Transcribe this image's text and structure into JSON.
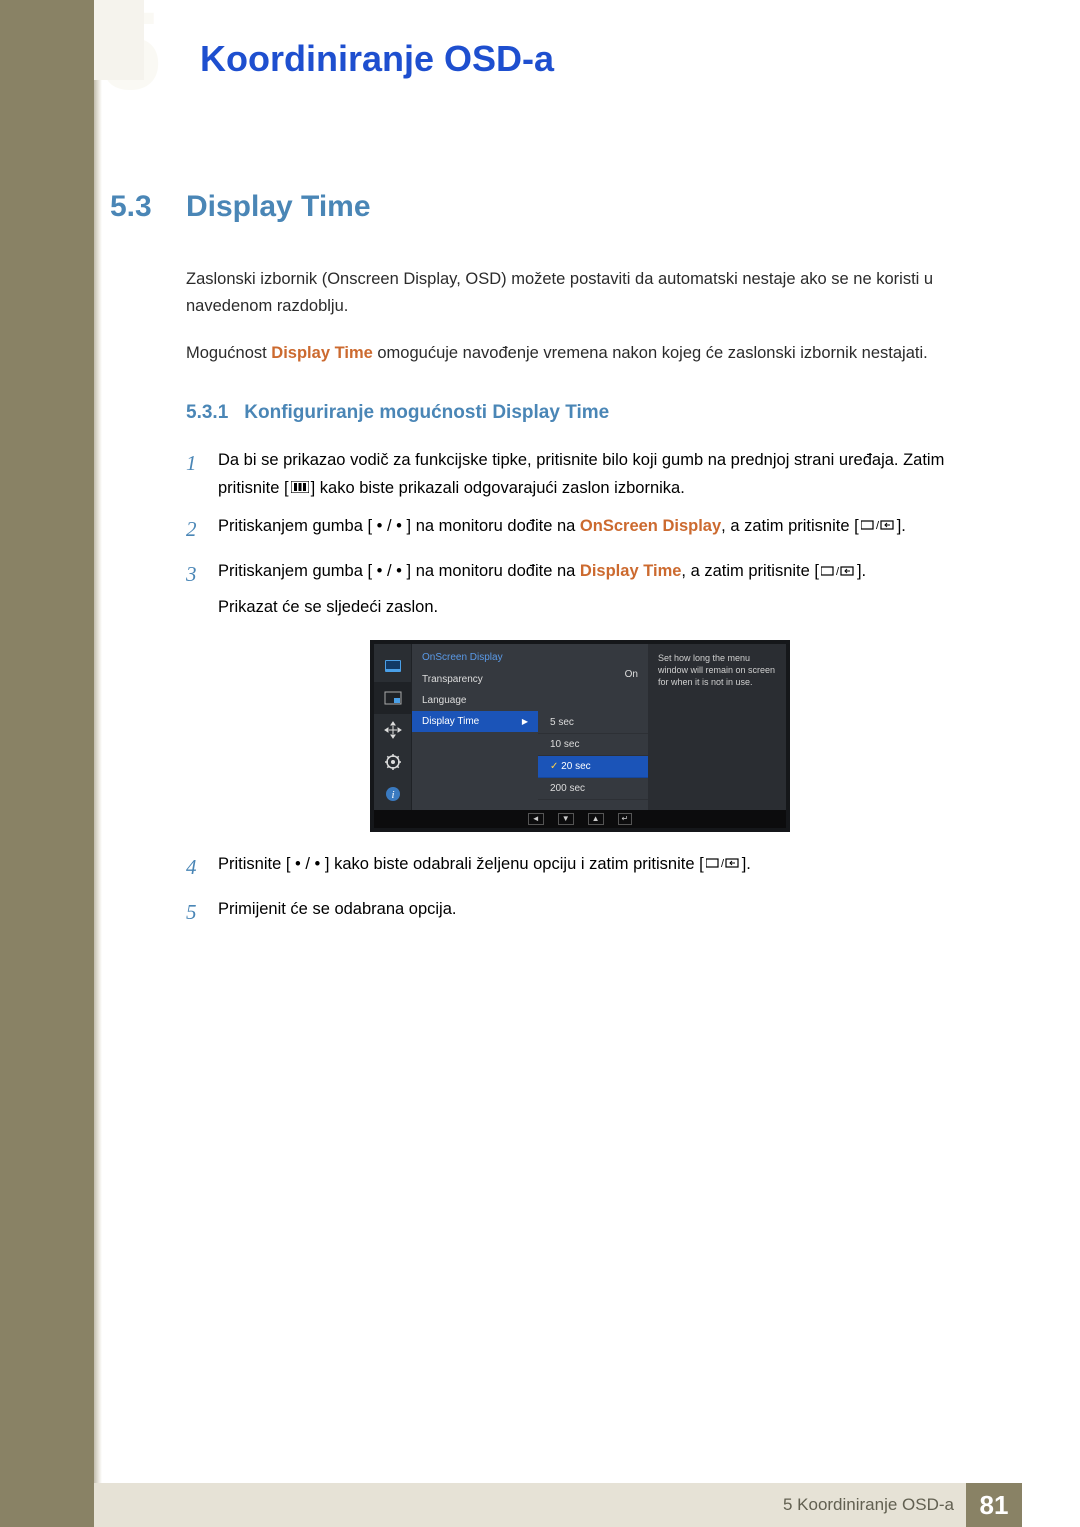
{
  "chapter_tab_number": "5",
  "doc_title": "Koordiniranje OSD-a",
  "section": {
    "num": "5.3",
    "title": "Display Time"
  },
  "intro_p1": "Zaslonski izbornik (Onscreen Display, OSD) možete postaviti da automatski nestaje ako se ne koristi u navedenom razdoblju.",
  "intro_p2_a": "Mogućnost ",
  "intro_p2_hl": "Display Time",
  "intro_p2_b": " omogućuje navođenje vremena nakon kojeg će zaslonski izbornik nestajati.",
  "subsection": {
    "num": "5.3.1",
    "title": "Konfiguriranje mogućnosti Display Time"
  },
  "steps": {
    "s1_a": "Da bi se prikazao vodič za funkcijske tipke, pritisnite bilo koji gumb na prednjoj strani uređaja. Zatim pritisnite [",
    "s1_b": "] kako biste prikazali odgovarajući zaslon izbornika.",
    "s2_a": "Pritiskanjem gumba [",
    "s2_dots": " • / • ",
    "s2_b": "] na monitoru dođite na ",
    "s2_hl": "OnScreen Display",
    "s2_c": ", a zatim pritisnite [",
    "s2_d": "].",
    "s3_a": "Pritiskanjem gumba [",
    "s3_b": "] na monitoru dođite na ",
    "s3_hl": "Display Time",
    "s3_c": ", a zatim pritisnite [",
    "s3_d": "].",
    "s3_e": "Prikazat će se sljedeći zaslon.",
    "s4_a": "Pritisnite [",
    "s4_b": "] kako biste odabrali željenu opciju i zatim pritisnite [",
    "s4_c": "].",
    "s5": "Primijenit će se odabrana opcija."
  },
  "osd": {
    "header": "OnScreen Display",
    "items": [
      {
        "label": "Transparency",
        "value": "On"
      },
      {
        "label": "Language",
        "value": ""
      },
      {
        "label": "Display Time",
        "value": ""
      }
    ],
    "options": [
      "5 sec",
      "10 sec",
      "20 sec",
      "200 sec"
    ],
    "selected_option_index": 2,
    "help": "Set how long the menu window will remain on screen for when it is not in use.",
    "nav_icons": [
      "◄",
      "▼",
      "▲",
      "↵"
    ]
  },
  "footer": {
    "label": "5 Koordiniranje OSD-a",
    "page": "81"
  }
}
